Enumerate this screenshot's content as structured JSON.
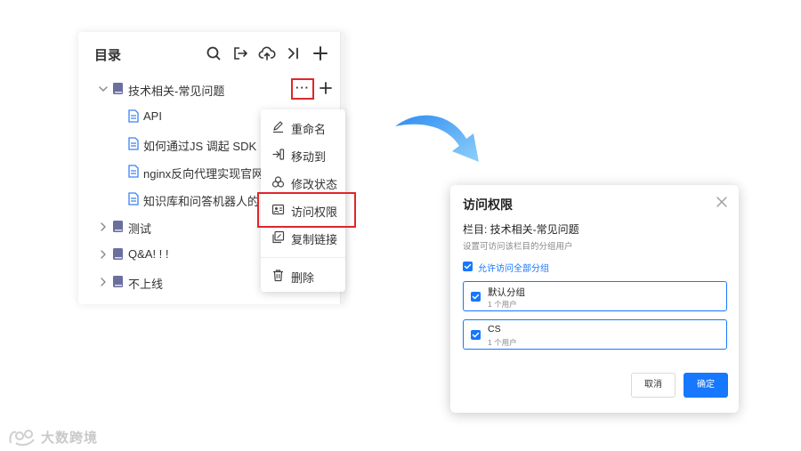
{
  "left_panel": {
    "title": "目录",
    "tree": [
      {
        "label": "技术相关-常见问题",
        "type": "folder",
        "expanded": true
      },
      {
        "label": "API",
        "type": "doc"
      },
      {
        "label": "如何通过JS 调起 SDK",
        "type": "doc"
      },
      {
        "label": "nginx反向代理实现官网",
        "type": "doc"
      },
      {
        "label": "知识库和问答机器人的",
        "type": "doc"
      },
      {
        "label": "测试",
        "type": "folder",
        "expanded": false
      },
      {
        "label": "Q&A! ! !",
        "type": "folder",
        "expanded": false
      },
      {
        "label": "不上线",
        "type": "folder",
        "expanded": false
      }
    ],
    "more_label": "···"
  },
  "context_menu": {
    "items": [
      {
        "label": "重命名",
        "icon": "edit-icon"
      },
      {
        "label": "移动到",
        "icon": "move-icon"
      },
      {
        "label": "修改状态",
        "icon": "status-icon"
      },
      {
        "label": "访问权限",
        "icon": "access-icon",
        "highlighted": true
      },
      {
        "label": "复制链接",
        "icon": "copy-link-icon"
      },
      {
        "label": "删除",
        "icon": "trash-icon"
      }
    ]
  },
  "dialog": {
    "title": "访问权限",
    "column_line": "栏目:  技术相关-常见问题",
    "description": "设置可访问该栏目的分组用户",
    "allow_all_label": "允许访问全部分组",
    "groups": [
      {
        "name": "默认分组",
        "count": "1 个用户",
        "checked": true
      },
      {
        "name": "CS",
        "count": "1 个用户",
        "checked": true
      }
    ],
    "cancel_label": "取消",
    "ok_label": "确定"
  },
  "watermark": {
    "text": "大数跨境"
  },
  "colors": {
    "accent": "#1677ff",
    "highlight_red": "#e0262b",
    "book_icon": "#6b6f9e",
    "doc_icon": "#3b82f6"
  }
}
